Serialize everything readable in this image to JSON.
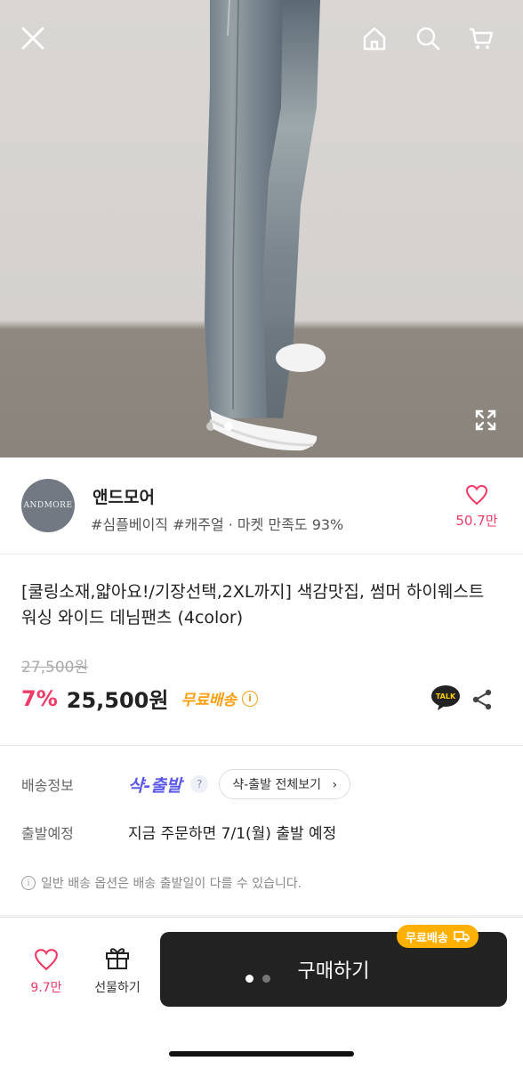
{
  "topbar": {
    "icons": [
      "close-icon",
      "home-icon",
      "search-icon",
      "cart-icon"
    ]
  },
  "gallery": {
    "current_index": 2,
    "total": 2,
    "expand_icon": "expand-icon"
  },
  "shop": {
    "logo_text": "ANDMORE",
    "name": "앤드모어",
    "tags": "#심플베이직 #캐주얼 · 마켓 만족도 93%",
    "like_count": "50.7만"
  },
  "product": {
    "title": "[쿨링소재,얇아요!/기장선택,2XL까지] 색감맛집, 썸머 하이웨스트 워싱 와이드 데님팬츠 (4color)",
    "original_price": "27,500원",
    "discount": "7%",
    "price": "25,500원",
    "free_shipping": "무료배송",
    "talk_label": "TALK"
  },
  "delivery": {
    "info_label": "배송정보",
    "service_name": "샥-출발",
    "view_all": "샥-출발 전체보기",
    "departure_label": "출발예정",
    "departure_value": "지금 주문하면 7/1(월) 출발 예정",
    "note": "일반 배송 옵션은 배송 출발일이 다를 수 있습니다."
  },
  "bottom": {
    "like_count": "9.7만",
    "gift_label": "선물하기",
    "buy_label": "구매하기",
    "free_badge": "무료배송"
  },
  "colors": {
    "accent_pink": "#ef3b66",
    "free_orange": "#ff9e0e",
    "shak_purple": "#5b58e8",
    "buy_button": "#222222"
  }
}
